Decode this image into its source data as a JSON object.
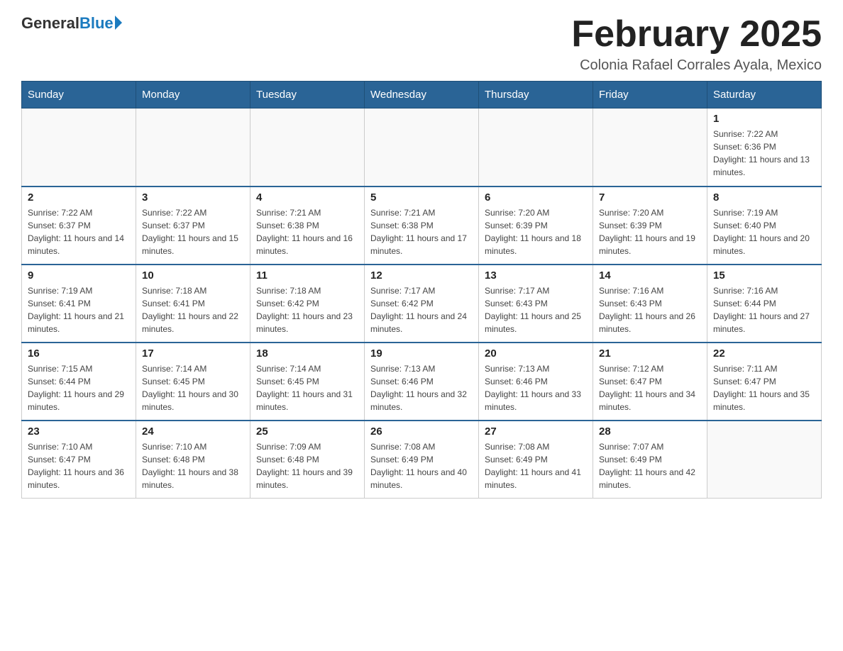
{
  "logo": {
    "general": "General",
    "blue": "Blue"
  },
  "title": "February 2025",
  "subtitle": "Colonia Rafael Corrales Ayala, Mexico",
  "days_of_week": [
    "Sunday",
    "Monday",
    "Tuesday",
    "Wednesday",
    "Thursday",
    "Friday",
    "Saturday"
  ],
  "weeks": [
    [
      {
        "day": "",
        "sunrise": "",
        "sunset": "",
        "daylight": ""
      },
      {
        "day": "",
        "sunrise": "",
        "sunset": "",
        "daylight": ""
      },
      {
        "day": "",
        "sunrise": "",
        "sunset": "",
        "daylight": ""
      },
      {
        "day": "",
        "sunrise": "",
        "sunset": "",
        "daylight": ""
      },
      {
        "day": "",
        "sunrise": "",
        "sunset": "",
        "daylight": ""
      },
      {
        "day": "",
        "sunrise": "",
        "sunset": "",
        "daylight": ""
      },
      {
        "day": "1",
        "sunrise": "Sunrise: 7:22 AM",
        "sunset": "Sunset: 6:36 PM",
        "daylight": "Daylight: 11 hours and 13 minutes."
      }
    ],
    [
      {
        "day": "2",
        "sunrise": "Sunrise: 7:22 AM",
        "sunset": "Sunset: 6:37 PM",
        "daylight": "Daylight: 11 hours and 14 minutes."
      },
      {
        "day": "3",
        "sunrise": "Sunrise: 7:22 AM",
        "sunset": "Sunset: 6:37 PM",
        "daylight": "Daylight: 11 hours and 15 minutes."
      },
      {
        "day": "4",
        "sunrise": "Sunrise: 7:21 AM",
        "sunset": "Sunset: 6:38 PM",
        "daylight": "Daylight: 11 hours and 16 minutes."
      },
      {
        "day": "5",
        "sunrise": "Sunrise: 7:21 AM",
        "sunset": "Sunset: 6:38 PM",
        "daylight": "Daylight: 11 hours and 17 minutes."
      },
      {
        "day": "6",
        "sunrise": "Sunrise: 7:20 AM",
        "sunset": "Sunset: 6:39 PM",
        "daylight": "Daylight: 11 hours and 18 minutes."
      },
      {
        "day": "7",
        "sunrise": "Sunrise: 7:20 AM",
        "sunset": "Sunset: 6:39 PM",
        "daylight": "Daylight: 11 hours and 19 minutes."
      },
      {
        "day": "8",
        "sunrise": "Sunrise: 7:19 AM",
        "sunset": "Sunset: 6:40 PM",
        "daylight": "Daylight: 11 hours and 20 minutes."
      }
    ],
    [
      {
        "day": "9",
        "sunrise": "Sunrise: 7:19 AM",
        "sunset": "Sunset: 6:41 PM",
        "daylight": "Daylight: 11 hours and 21 minutes."
      },
      {
        "day": "10",
        "sunrise": "Sunrise: 7:18 AM",
        "sunset": "Sunset: 6:41 PM",
        "daylight": "Daylight: 11 hours and 22 minutes."
      },
      {
        "day": "11",
        "sunrise": "Sunrise: 7:18 AM",
        "sunset": "Sunset: 6:42 PM",
        "daylight": "Daylight: 11 hours and 23 minutes."
      },
      {
        "day": "12",
        "sunrise": "Sunrise: 7:17 AM",
        "sunset": "Sunset: 6:42 PM",
        "daylight": "Daylight: 11 hours and 24 minutes."
      },
      {
        "day": "13",
        "sunrise": "Sunrise: 7:17 AM",
        "sunset": "Sunset: 6:43 PM",
        "daylight": "Daylight: 11 hours and 25 minutes."
      },
      {
        "day": "14",
        "sunrise": "Sunrise: 7:16 AM",
        "sunset": "Sunset: 6:43 PM",
        "daylight": "Daylight: 11 hours and 26 minutes."
      },
      {
        "day": "15",
        "sunrise": "Sunrise: 7:16 AM",
        "sunset": "Sunset: 6:44 PM",
        "daylight": "Daylight: 11 hours and 27 minutes."
      }
    ],
    [
      {
        "day": "16",
        "sunrise": "Sunrise: 7:15 AM",
        "sunset": "Sunset: 6:44 PM",
        "daylight": "Daylight: 11 hours and 29 minutes."
      },
      {
        "day": "17",
        "sunrise": "Sunrise: 7:14 AM",
        "sunset": "Sunset: 6:45 PM",
        "daylight": "Daylight: 11 hours and 30 minutes."
      },
      {
        "day": "18",
        "sunrise": "Sunrise: 7:14 AM",
        "sunset": "Sunset: 6:45 PM",
        "daylight": "Daylight: 11 hours and 31 minutes."
      },
      {
        "day": "19",
        "sunrise": "Sunrise: 7:13 AM",
        "sunset": "Sunset: 6:46 PM",
        "daylight": "Daylight: 11 hours and 32 minutes."
      },
      {
        "day": "20",
        "sunrise": "Sunrise: 7:13 AM",
        "sunset": "Sunset: 6:46 PM",
        "daylight": "Daylight: 11 hours and 33 minutes."
      },
      {
        "day": "21",
        "sunrise": "Sunrise: 7:12 AM",
        "sunset": "Sunset: 6:47 PM",
        "daylight": "Daylight: 11 hours and 34 minutes."
      },
      {
        "day": "22",
        "sunrise": "Sunrise: 7:11 AM",
        "sunset": "Sunset: 6:47 PM",
        "daylight": "Daylight: 11 hours and 35 minutes."
      }
    ],
    [
      {
        "day": "23",
        "sunrise": "Sunrise: 7:10 AM",
        "sunset": "Sunset: 6:47 PM",
        "daylight": "Daylight: 11 hours and 36 minutes."
      },
      {
        "day": "24",
        "sunrise": "Sunrise: 7:10 AM",
        "sunset": "Sunset: 6:48 PM",
        "daylight": "Daylight: 11 hours and 38 minutes."
      },
      {
        "day": "25",
        "sunrise": "Sunrise: 7:09 AM",
        "sunset": "Sunset: 6:48 PM",
        "daylight": "Daylight: 11 hours and 39 minutes."
      },
      {
        "day": "26",
        "sunrise": "Sunrise: 7:08 AM",
        "sunset": "Sunset: 6:49 PM",
        "daylight": "Daylight: 11 hours and 40 minutes."
      },
      {
        "day": "27",
        "sunrise": "Sunrise: 7:08 AM",
        "sunset": "Sunset: 6:49 PM",
        "daylight": "Daylight: 11 hours and 41 minutes."
      },
      {
        "day": "28",
        "sunrise": "Sunrise: 7:07 AM",
        "sunset": "Sunset: 6:49 PM",
        "daylight": "Daylight: 11 hours and 42 minutes."
      },
      {
        "day": "",
        "sunrise": "",
        "sunset": "",
        "daylight": ""
      }
    ]
  ]
}
